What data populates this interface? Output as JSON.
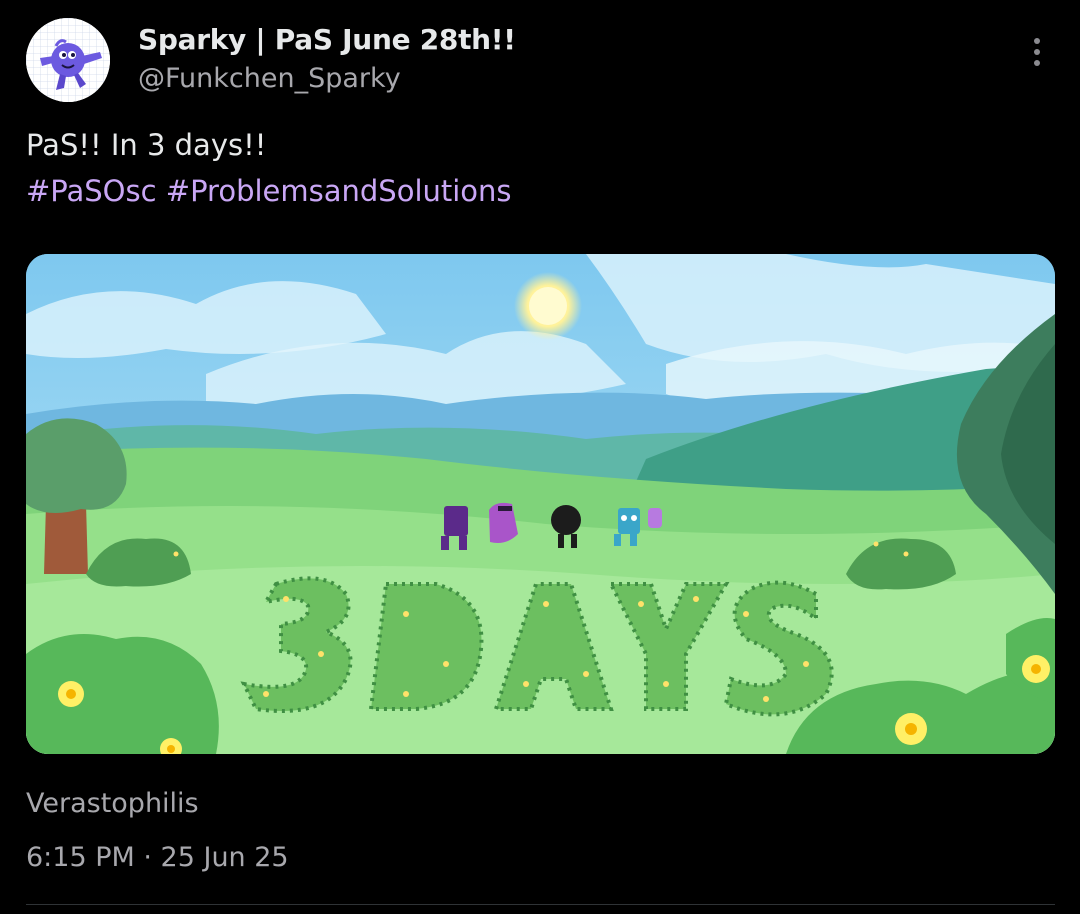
{
  "author": {
    "display_name": "Sparky | PaS June 28th!!",
    "handle": "@Funkchen_Sparky",
    "avatar_icon": "purple-character-avatar-icon"
  },
  "post": {
    "text_line": "PaS!! In 3 days!!",
    "hashtags": [
      "#PaSOsc",
      "#ProblemsandSolutions"
    ],
    "hashtag_color": "#c9a7f5",
    "attribution": "Verastophilis",
    "timestamp": "6:15 PM · 25 Jun 25"
  },
  "media": {
    "image_icon": "3-days-countdown-illustration",
    "grass_text": "3 DAYS"
  },
  "colors": {
    "background": "#000000",
    "text_primary": "#e7e9ea",
    "text_secondary": "#a8a8ad"
  },
  "icons": {
    "more": "more-vertical-icon"
  }
}
